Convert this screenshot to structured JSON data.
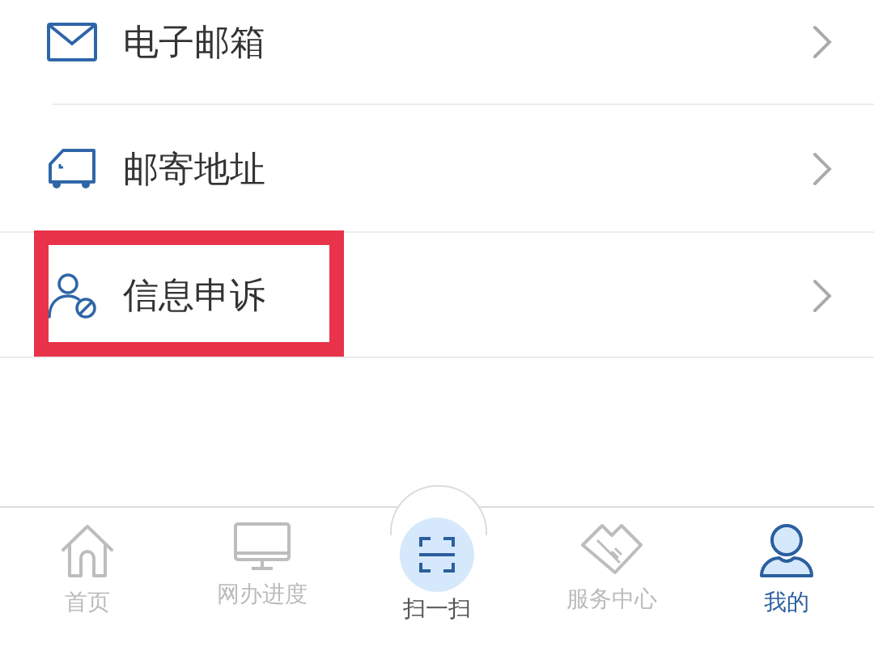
{
  "menu": [
    {
      "kind": "mail",
      "label": "电子邮箱",
      "highlighted": false
    },
    {
      "kind": "truck",
      "label": "邮寄地址",
      "highlighted": false
    },
    {
      "kind": "user-block",
      "label": "信息申诉",
      "highlighted": true
    }
  ],
  "tab_bar": [
    {
      "kind": "home",
      "label": "首页",
      "selected": false
    },
    {
      "kind": "monitor",
      "label": "网办进度",
      "selected": false
    },
    {
      "kind": "scan",
      "label": "扫一扫",
      "selected": false
    },
    {
      "kind": "handshake",
      "label": "服务中心",
      "selected": false
    },
    {
      "kind": "user",
      "label": "我的",
      "selected": true
    }
  ]
}
